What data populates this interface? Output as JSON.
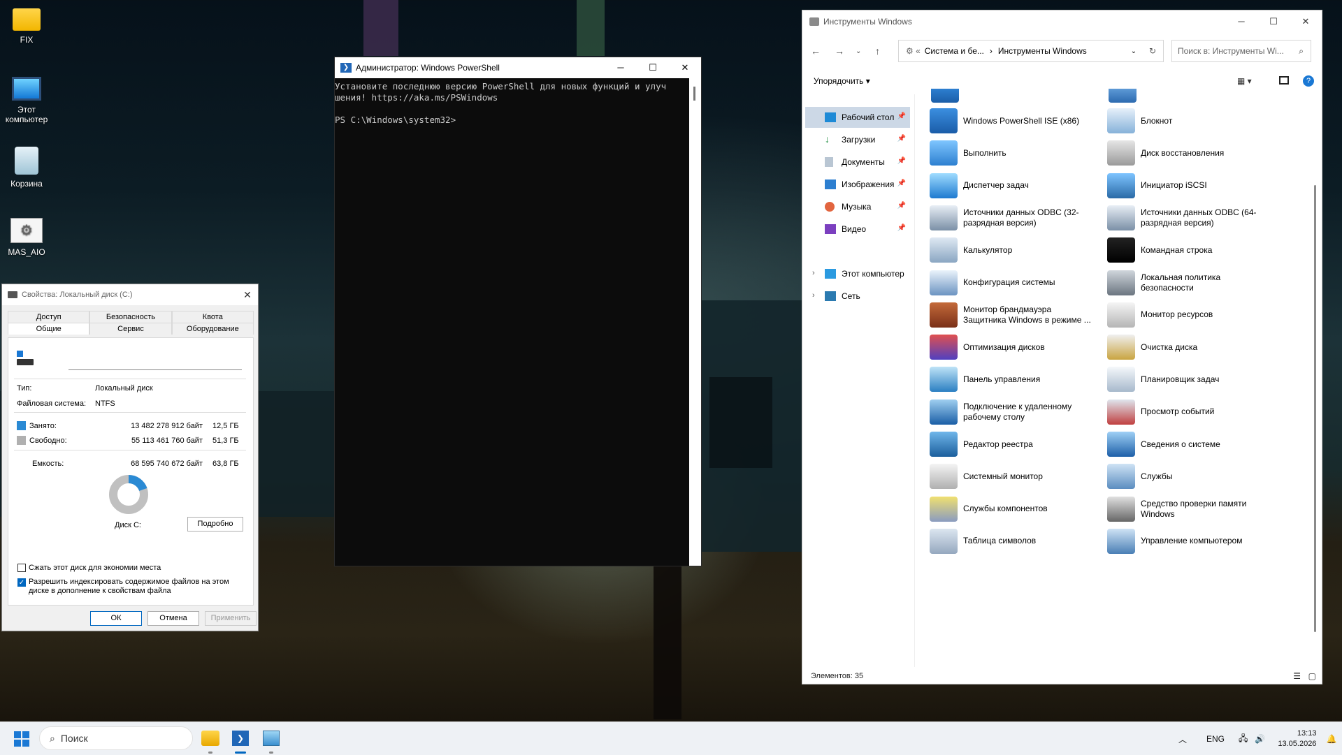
{
  "desktop": {
    "icons": [
      {
        "label": "FIX"
      },
      {
        "label": "Этот компьютер"
      },
      {
        "label": "Корзина"
      },
      {
        "label": "MAS_AIO"
      }
    ]
  },
  "properties": {
    "title": "Свойства: Локальный диск (C:)",
    "tabs_top": [
      "Доступ",
      "Безопасность",
      "Квота"
    ],
    "tabs_bottom": [
      "Общие",
      "Сервис",
      "Оборудование"
    ],
    "name_value": "",
    "type_label": "Тип:",
    "type_value": "Локальный диск",
    "fs_label": "Файловая система:",
    "fs_value": "NTFS",
    "used_label": "Занято:",
    "used_bytes": "13 482 278 912 байт",
    "used_gb": "12,5 ГБ",
    "free_label": "Свободно:",
    "free_bytes": "55 113 461 760 байт",
    "free_gb": "51,3 ГБ",
    "capacity_label": "Емкость:",
    "capacity_bytes": "68 595 740 672 байт",
    "capacity_gb": "63,8 ГБ",
    "used_fraction": 0.197,
    "used_color": "#2a8ad4",
    "free_color": "#c0c0c0",
    "disk_label": "Диск C:",
    "details_button": "Подробно",
    "compress_label": "Сжать этот диск для экономии места",
    "index_label": "Разрешить индексировать содержимое файлов на этом диске в дополнение к свойствам файла",
    "ok": "ОК",
    "cancel": "Отмена",
    "apply": "Применить"
  },
  "powershell": {
    "title": "Администратор: Windows PowerShell",
    "line1": "Установите последнюю версию PowerShell для новых функций и улуч",
    "line2": "шения! https://aka.ms/PSWindows",
    "line3": "",
    "prompt": "PS C:\\Windows\\system32>"
  },
  "explorer": {
    "title": "Инструменты Windows",
    "breadcrumb_1": "Система и бе...",
    "breadcrumb_2": "Инструменты Windows",
    "search_placeholder": "Поиск в: Инструменты Wi...",
    "sort_label": "Упорядочить",
    "nav": [
      {
        "label": "Рабочий стол"
      },
      {
        "label": "Загрузки"
      },
      {
        "label": "Документы"
      },
      {
        "label": "Изображения"
      },
      {
        "label": "Музыка"
      },
      {
        "label": "Видео"
      },
      {
        "label": "Этот компьютер"
      },
      {
        "label": "Сеть"
      }
    ],
    "items_left": [
      {
        "label": "Windows PowerShell ISE (x86)"
      },
      {
        "label": "Выполнить"
      },
      {
        "label": "Диспетчер задач"
      },
      {
        "label": "Источники данных ODBC (32-разрядная версия)"
      },
      {
        "label": "Калькулятор"
      },
      {
        "label": "Конфигурация системы"
      },
      {
        "label": "Монитор брандмауэра Защитника Windows в режиме ..."
      },
      {
        "label": "Оптимизация дисков"
      },
      {
        "label": "Панель управления"
      },
      {
        "label": "Подключение к удаленному рабочему столу"
      },
      {
        "label": "Редактор реестра"
      },
      {
        "label": "Системный монитор"
      },
      {
        "label": "Службы компонентов"
      },
      {
        "label": "Таблица символов"
      }
    ],
    "items_right": [
      {
        "label": "Блокнот"
      },
      {
        "label": "Диск восстановления"
      },
      {
        "label": "Инициатор iSCSI"
      },
      {
        "label": "Источники данных ODBC (64-разрядная версия)"
      },
      {
        "label": "Командная строка"
      },
      {
        "label": "Локальная политика безопасности"
      },
      {
        "label": "Монитор ресурсов"
      },
      {
        "label": "Очистка диска"
      },
      {
        "label": "Планировщик задач"
      },
      {
        "label": "Просмотр событий"
      },
      {
        "label": "Сведения о системе"
      },
      {
        "label": "Службы"
      },
      {
        "label": "Средство проверки памяти Windows"
      },
      {
        "label": "Управление компьютером"
      }
    ],
    "status": "Элементов: 35"
  },
  "taskbar": {
    "search_placeholder": "Поиск",
    "lang": "ENG",
    "time": "13:13",
    "date": "13.05.2026"
  }
}
